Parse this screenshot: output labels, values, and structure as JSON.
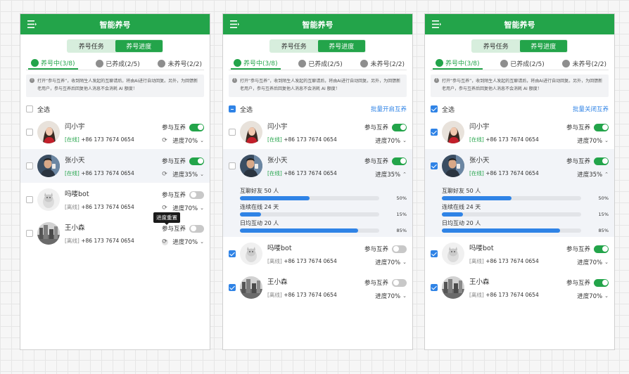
{
  "app_title": "智能养号",
  "seg_tabs": [
    "养号任务",
    "养号进度"
  ],
  "status_tabs": {
    "raising": "养号中(3/8)",
    "done": "已养成(2/5)",
    "not": "未养号(2/2)"
  },
  "notice": "打开“参与互养”，收到陌生人发起的互聊请后，将由AI进行自动回复。另外，为回馈新老用户，参与互养后回复他人消息不会消耗 AI 额度！",
  "select_all": "全选",
  "batch_open": "批量开启互养",
  "batch_close": "批量关闭互养",
  "participate_label": "参与互养",
  "tooltip_reset": "进度重置",
  "accounts": [
    {
      "name": "闫小宇",
      "status": "[在线]",
      "phone": "+86 173 7674 0654",
      "progress": "进度70%",
      "progress_value": 70,
      "participating": true,
      "avatar": "woman"
    },
    {
      "name": "张小天",
      "status": "[在线]",
      "phone": "+86 173 7674 0654",
      "progress": "进度35%",
      "progress_value": 35,
      "participating": true,
      "avatar": "man"
    },
    {
      "name": "吗喽bot",
      "status": "[离线]",
      "phone": "+86 173 7674 0654",
      "progress": "进度70%",
      "progress_value": 70,
      "participating": false,
      "avatar": "cat"
    },
    {
      "name": "王小森",
      "status": "[离线]",
      "phone": "+86 173 7674 0654",
      "progress": "进度70%",
      "progress_value": 70,
      "participating": false,
      "avatar": "city"
    }
  ],
  "detail_items": [
    {
      "label": "互聊好友 50 人",
      "pct": "50%",
      "value": 50
    },
    {
      "label": "连续在线 24 天",
      "pct": "15%",
      "value": 15
    },
    {
      "label": "日均互动 20 人",
      "pct": "85%",
      "value": 85
    }
  ],
  "colors": {
    "brand": "#23a44a",
    "accent_blue": "#2f83e6"
  }
}
